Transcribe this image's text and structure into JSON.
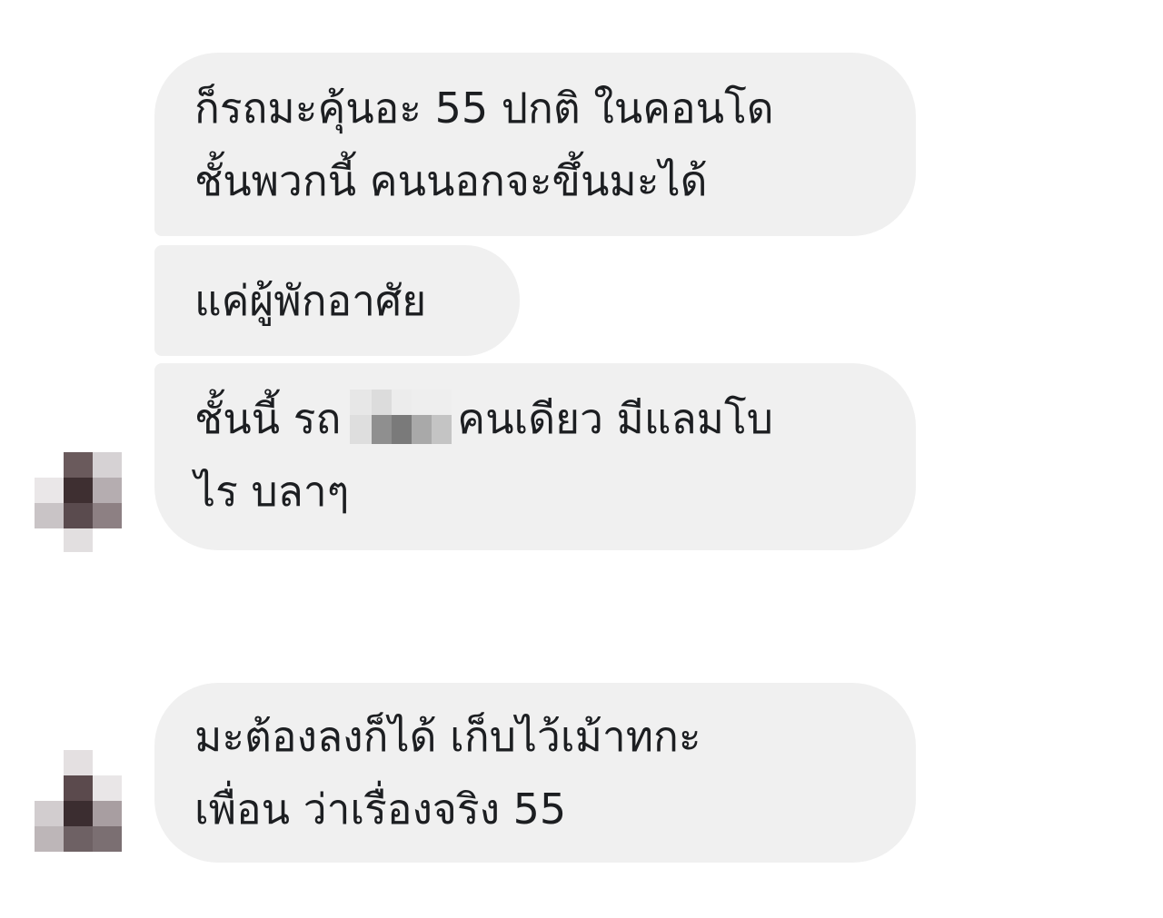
{
  "conversation": {
    "messages": [
      {
        "lines": [
          "ก็รถมะคุ้นอะ 55 ปกติ ในคอนโด",
          "ชั้นพวกนี้ คนนอกจะขึ้นมะได้"
        ]
      },
      {
        "lines": [
          "แค่ผู้พักอาศัย"
        ]
      },
      {
        "line1_before": "ชั้นนี้ รถ",
        "line1_after": "คนเดียว มีแลมโบ",
        "line2": "ไร บลาๆ"
      },
      {
        "lines": [
          "มะต้องลงก็ได้ เก็บไว้เม้าทกะ",
          "เพื่อน ว่าเรื่องจริง 55"
        ]
      }
    ]
  },
  "colors": {
    "bubble_background": "#f0f0f0",
    "text": "#1c1e21",
    "page_background": "#ffffff"
  },
  "icons": {
    "sender_avatar": "pixelated-avatar",
    "redaction": "pixelated-redaction"
  }
}
